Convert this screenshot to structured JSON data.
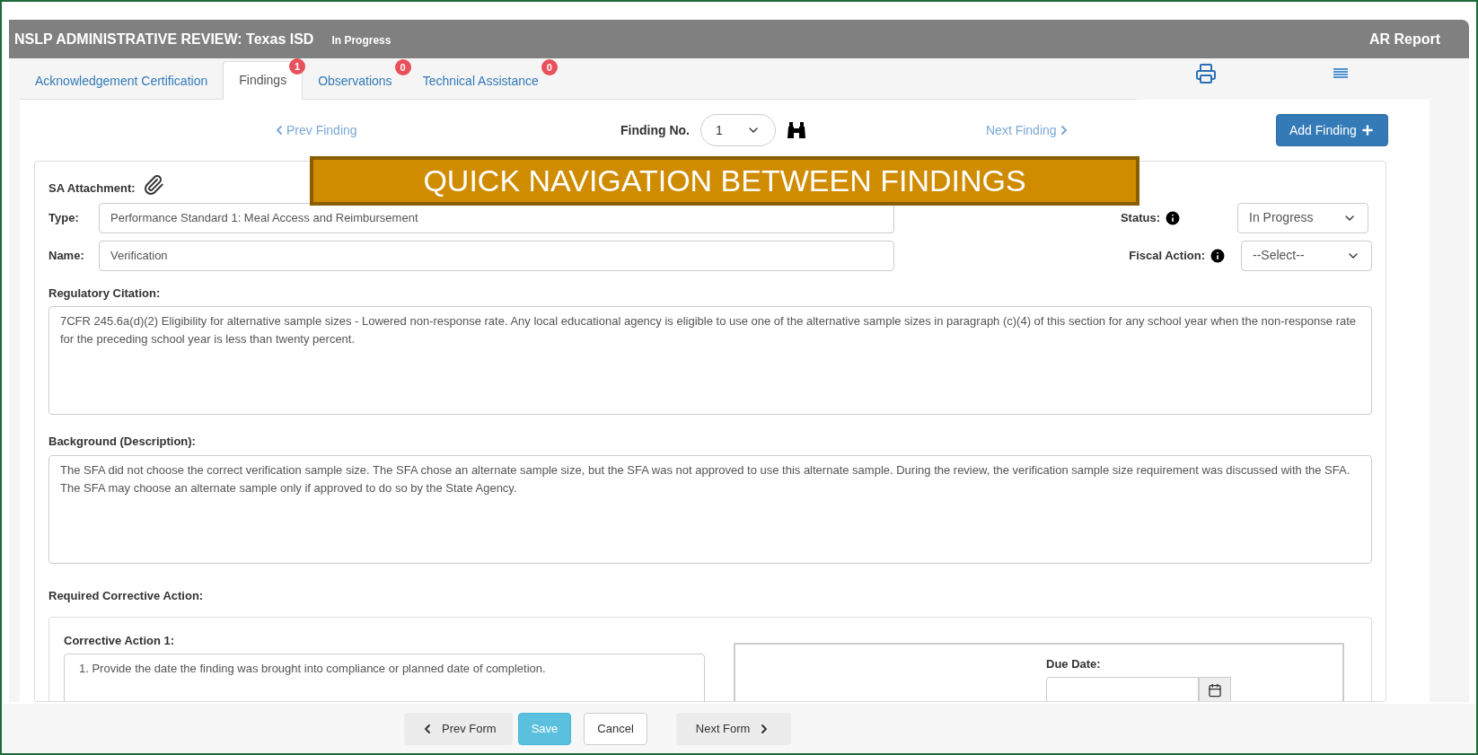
{
  "header": {
    "title": "NSLP ADMINISTRATIVE REVIEW: Texas ISD",
    "status": "In Progress",
    "report_link": "AR Report"
  },
  "tabs": [
    {
      "label": "Acknowledgement Certification",
      "selected": false
    },
    {
      "label": "Findings",
      "selected": true,
      "badge": "1"
    },
    {
      "label": "Observations",
      "selected": false,
      "badge": "0"
    },
    {
      "label": "Technical Assistance",
      "selected": false,
      "badge": "0"
    }
  ],
  "finding_nav": {
    "prev": "Prev Finding",
    "label": "Finding No.",
    "number": "1",
    "next": "Next Finding",
    "add_button": "Add Finding"
  },
  "callout": "QUICK NAVIGATION BETWEEN FINDINGS",
  "form": {
    "attachment_label": "SA Attachment:",
    "type_label": "Type:",
    "type_value": "Performance Standard 1: Meal Access and Reimbursement",
    "name_label": "Name:",
    "name_value": "Verification",
    "status_label": "Status:",
    "status_value": "In Progress",
    "fiscal_label": "Fiscal Action:",
    "fiscal_value": "--Select--",
    "citation_label": "Regulatory Citation:",
    "citation_value": "7CFR 245.6a(d)(2) Eligibility for alternative sample sizes - Lowered non-response rate.  Any local educational agency is eligible to use one of the alternative sample sizes in paragraph (c)(4) of this section for any school year when the non-response rate for the preceding school year is less than twenty percent.",
    "background_label": "Background (Description):",
    "background_value": "The SFA did not choose the correct verification sample size.  The SFA chose an alternate sample size, but the SFA was not approved to use this alternate sample.  During the review, the verification sample size requirement was discussed with the SFA.  The SFA may choose an alternate sample only if approved to do so by the State Agency.",
    "corrective_label": "Required Corrective Action:",
    "corrective_action_label": "Corrective Action 1:",
    "corrective_action_value": "1. Provide the date the finding was brought into compliance or planned date of completion.",
    "due_date_label": "Due Date:"
  },
  "footer": {
    "prev": "Prev Form",
    "save": "Save",
    "cancel": "Cancel",
    "next": "Next Form"
  }
}
